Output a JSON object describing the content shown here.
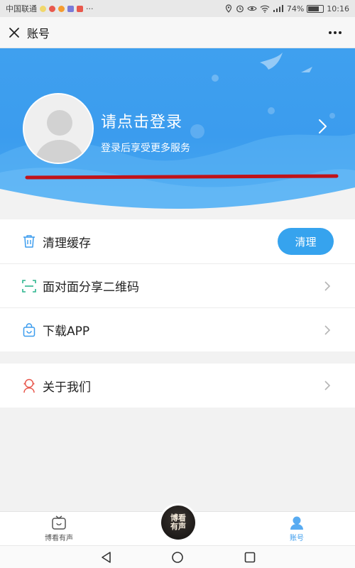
{
  "status_bar": {
    "carrier": "中国联通",
    "more_indicator": "···",
    "battery": "74%",
    "battery_level": 0.74,
    "time": "10:16"
  },
  "header": {
    "title": "账号",
    "close_icon": "close-icon",
    "more_icon": "more-dots-icon"
  },
  "banner": {
    "login_title": "请点击登录",
    "login_subtitle": "登录后享受更多服务",
    "background_color": "#3b9cee",
    "underline_color": "#c0131a"
  },
  "menu": {
    "group1": [
      {
        "icon": "trash-icon",
        "label": "清理缓存",
        "action_label": "清理"
      },
      {
        "icon": "qrcode-scan-icon",
        "label": "面对面分享二维码"
      },
      {
        "icon": "shopping-bag-icon",
        "label": "下载APP"
      }
    ],
    "group2": [
      {
        "icon": "user-support-icon",
        "label": "关于我们"
      }
    ]
  },
  "tab_bar": {
    "items": [
      {
        "icon": "tv-box-icon",
        "label": "博看有声"
      },
      {
        "icon": "user-account-icon",
        "label": "账号",
        "active": true
      }
    ],
    "center_logo_text": "博看有声",
    "accent_color": "#3b9cee"
  },
  "nav_bar": {
    "icons": [
      "back-triangle-icon",
      "home-circle-icon",
      "recents-square-icon"
    ]
  }
}
